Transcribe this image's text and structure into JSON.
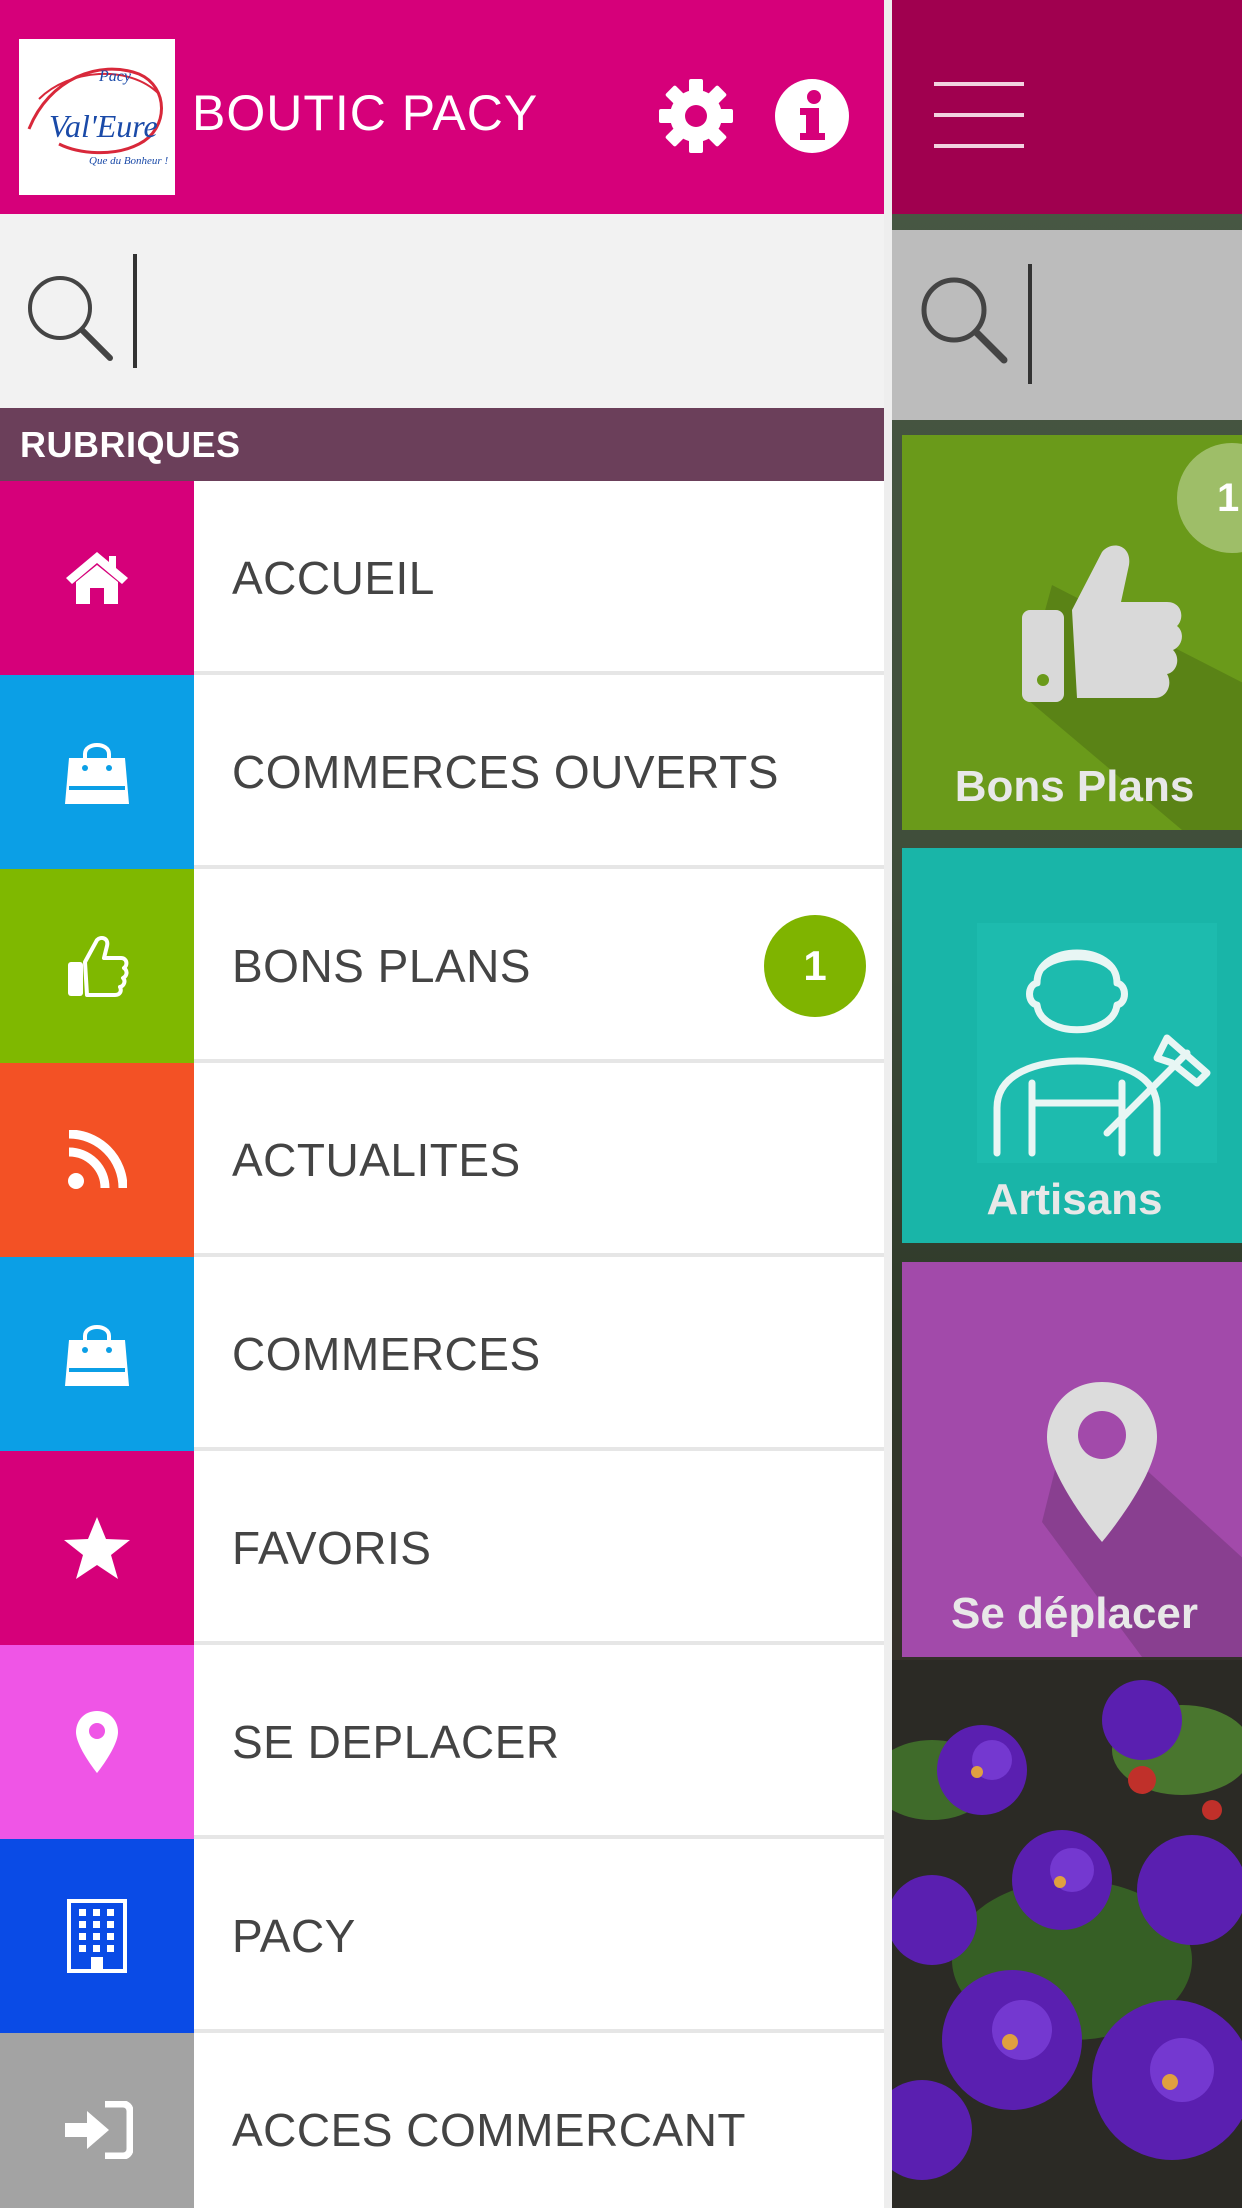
{
  "header": {
    "logo_text": "Pacy Val'Eure",
    "logo_tagline": "Que du Bonheur !",
    "title": "BOUTIC PACY"
  },
  "search": {
    "placeholder": ""
  },
  "section_title": "RUBRIQUES",
  "menu": {
    "items": [
      {
        "label": "ACCUEIL",
        "icon": "home-icon",
        "color": "#d6007a",
        "badge": ""
      },
      {
        "label": "COMMERCES OUVERTS",
        "icon": "shopping-bag-icon",
        "color": "#0b9fe6",
        "badge": ""
      },
      {
        "label": "BONS PLANS",
        "icon": "thumbs-up-icon",
        "color": "#7fb800",
        "badge": "1"
      },
      {
        "label": "ACTUALITES",
        "icon": "rss-icon",
        "color": "#f35125",
        "badge": ""
      },
      {
        "label": "COMMERCES",
        "icon": "shopping-bag-icon",
        "color": "#0b9fe6",
        "badge": ""
      },
      {
        "label": "FAVORIS",
        "icon": "star-icon",
        "color": "#d6007a",
        "badge": ""
      },
      {
        "label": "SE DEPLACER",
        "icon": "map-pin-icon",
        "color": "#ef55e6",
        "badge": ""
      },
      {
        "label": "PACY",
        "icon": "building-icon",
        "color": "#0a4be6",
        "badge": ""
      },
      {
        "label": "ACCES COMMERCANT",
        "icon": "sign-in-icon",
        "color": "#a3a3a3",
        "badge": ""
      }
    ]
  },
  "background": {
    "tiles": [
      {
        "label": "Bons Plans",
        "badge": "1",
        "color": "#6a9a1a"
      },
      {
        "label": "Artisans",
        "color": "#19b5a8"
      },
      {
        "label": "Se déplacer",
        "color": "#a24aaa"
      }
    ]
  },
  "colors": {
    "primary": "#d6007a",
    "section": "#6b3f5a",
    "badge": "#7fb400"
  }
}
